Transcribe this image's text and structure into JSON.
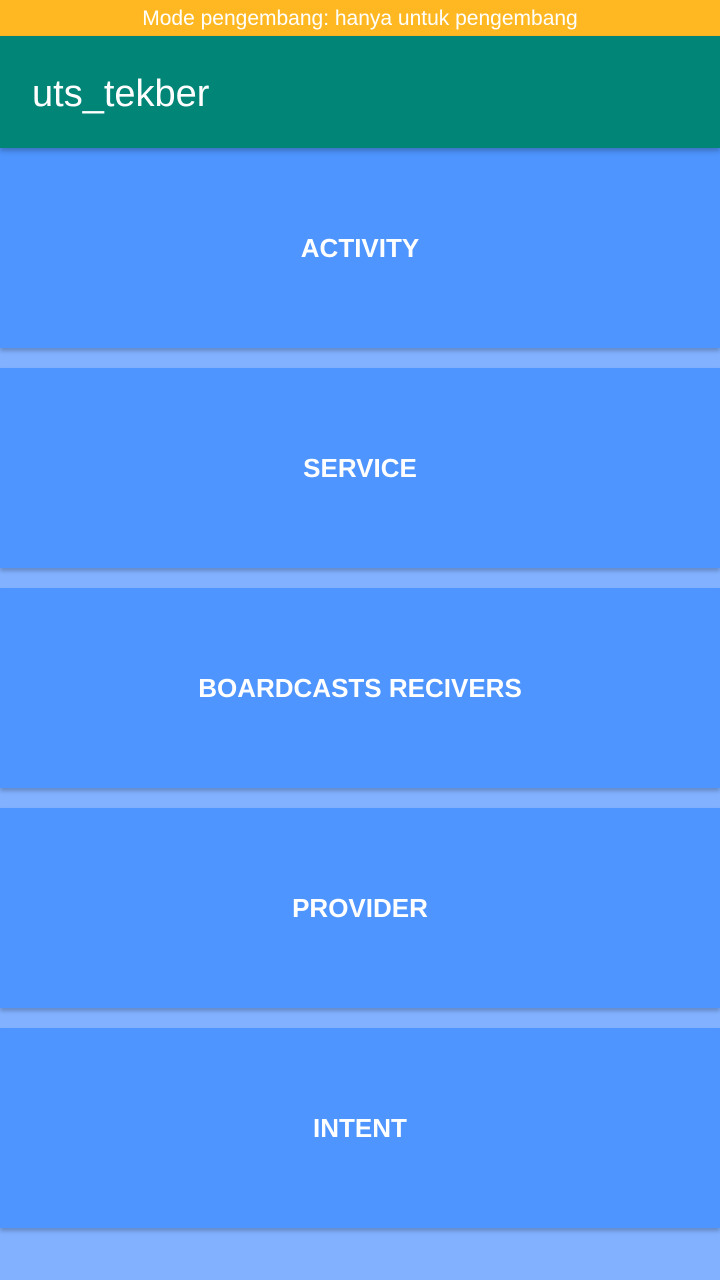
{
  "status_banner": {
    "text": "Mode pengembang: hanya untuk pengembang",
    "color": "#ffb822"
  },
  "app_bar": {
    "title": "uts_tekber",
    "color": "#018577"
  },
  "buttons": [
    {
      "label": "ACTIVITY"
    },
    {
      "label": "SERVICE"
    },
    {
      "label": "BOARDCASTS RECIVERS"
    },
    {
      "label": "PROVIDER"
    },
    {
      "label": "INTENT"
    }
  ],
  "colors": {
    "button": "#4e95ff",
    "background": "#82b1ff"
  }
}
